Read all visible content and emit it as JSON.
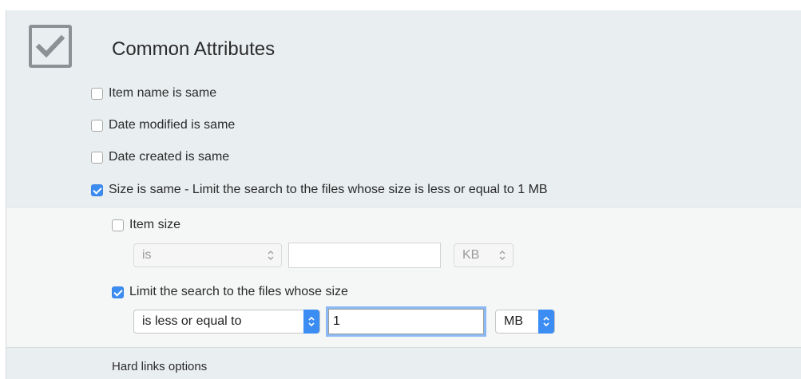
{
  "section": {
    "title": "Common Attributes",
    "checked": true
  },
  "options": [
    {
      "label": "Item name is same",
      "checked": false
    },
    {
      "label": "Date modified is same",
      "checked": false
    },
    {
      "label": "Date created is same",
      "checked": false
    },
    {
      "label": "Size is same - Limit the search to the files whose size is less or equal to 1 MB",
      "checked": true
    }
  ],
  "item_size": {
    "label": "Item size",
    "checked": false,
    "comparison": "is",
    "value": "",
    "unit": "KB"
  },
  "limit": {
    "label": "Limit the search to the files whose size",
    "checked": true,
    "comparison": "is less or equal to",
    "value": "1",
    "unit": "MB"
  },
  "hard_links": {
    "label": "Hard links options"
  },
  "colors": {
    "accent": "#3b8df3",
    "panel": "#e9eef0",
    "subpanel": "#f5f6f6"
  }
}
